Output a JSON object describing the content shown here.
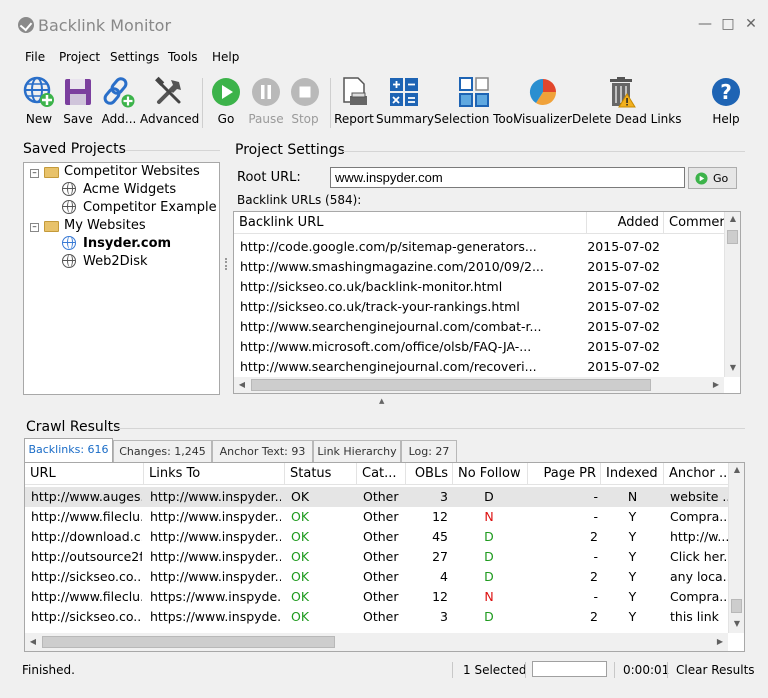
{
  "app": {
    "title": "Backlink Monitor"
  },
  "menu": [
    "File",
    "Project",
    "Settings",
    "Tools",
    "Help"
  ],
  "toolbar": {
    "new": "New",
    "save": "Save",
    "add": "Add...",
    "advanced": "Advanced",
    "go": "Go",
    "pause": "Pause",
    "stop": "Stop",
    "report": "Report",
    "summary": "Summary",
    "selection_tool": "Selection Tool",
    "visualizer": "Visualizer",
    "delete_dead_links": "Delete Dead Links",
    "help": "Help"
  },
  "saved_projects": {
    "title": "Saved Projects",
    "groups": [
      {
        "name": "Competitor Websites",
        "items": [
          "Acme Widgets",
          "Competitor Example"
        ]
      },
      {
        "name": "My Websites",
        "items": [
          "Insyder.com",
          "Web2Disk"
        ]
      }
    ]
  },
  "project_settings": {
    "title": "Project Settings",
    "root_url_label": "Root URL:",
    "root_url_value": "www.inspyder.com",
    "go_label": "Go",
    "backlink_urls_label": "Backlink URLs (584):",
    "columns": [
      "Backlink URL",
      "Added",
      "Commer"
    ],
    "rows": [
      {
        "url": "http://code.google.com/p/sitemap-generators...",
        "added": "2015-07-02"
      },
      {
        "url": "http://www.smashingmagazine.com/2010/09/2...",
        "added": "2015-07-02"
      },
      {
        "url": "http://sickseo.co.uk/backlink-monitor.html",
        "added": "2015-07-02"
      },
      {
        "url": "http://sickseo.co.uk/track-your-rankings.html",
        "added": "2015-07-02"
      },
      {
        "url": "http://www.searchenginejournal.com/combat-r...",
        "added": "2015-07-02"
      },
      {
        "url": "http://www.microsoft.com/office/olsb/FAQ-JA-...",
        "added": "2015-07-02"
      },
      {
        "url": "http://www.searchenginejournal.com/recoveri...",
        "added": "2015-07-02"
      }
    ]
  },
  "crawl_results": {
    "title": "Crawl Results",
    "tabs": [
      "Backlinks: 616",
      "Changes: 1,245",
      "Anchor Text: 93",
      "Link Hierarchy",
      "Log: 27"
    ],
    "columns": [
      "URL",
      "Links To",
      "Status",
      "Cat...",
      "OBLs",
      "No Follow",
      "Page PR",
      "Indexed",
      "Anchor ..."
    ],
    "rows": [
      {
        "url": "http://www.auges...",
        "links_to": "http://www.inspyder....",
        "status": "OK",
        "cat": "Other",
        "obls": "3",
        "nofollow": "D",
        "pr": "-",
        "indexed": "N",
        "anchor": "website ..."
      },
      {
        "url": "http://www.fileclu...",
        "links_to": "http://www.inspyder....",
        "status": "OK",
        "cat": "Other",
        "obls": "12",
        "nofollow": "N",
        "pr": "-",
        "indexed": "Y",
        "anchor": "Compra..."
      },
      {
        "url": "http://download.c...",
        "links_to": "http://www.inspyder....",
        "status": "OK",
        "cat": "Other",
        "obls": "45",
        "nofollow": "D",
        "pr": "2",
        "indexed": "Y",
        "anchor": "http://w..."
      },
      {
        "url": "http://outsource2f...",
        "links_to": "http://www.inspyder....",
        "status": "OK",
        "cat": "Other",
        "obls": "27",
        "nofollow": "D",
        "pr": "-",
        "indexed": "Y",
        "anchor": "Click her..."
      },
      {
        "url": "http://sickseo.co....",
        "links_to": "http://www.inspyder....",
        "status": "OK",
        "cat": "Other",
        "obls": "4",
        "nofollow": "D",
        "pr": "2",
        "indexed": "Y",
        "anchor": "any loca..."
      },
      {
        "url": "http://www.fileclu...",
        "links_to": "https://www.inspyde...",
        "status": "OK",
        "cat": "Other",
        "obls": "12",
        "nofollow": "N",
        "pr": "-",
        "indexed": "Y",
        "anchor": "Compra..."
      },
      {
        "url": "http://sickseo.co....",
        "links_to": "https://www.inspyde...",
        "status": "OK",
        "cat": "Other",
        "obls": "3",
        "nofollow": "D",
        "pr": "2",
        "indexed": "Y",
        "anchor": "this link"
      }
    ]
  },
  "statusbar": {
    "message": "Finished.",
    "selected": "1 Selected",
    "elapsed": "0:00:01",
    "clear": "Clear Results"
  },
  "colors": {
    "accent": "#1a6cc7",
    "ok_green": "#1e9a1e",
    "nofollow_red": "#dd1111",
    "go_green": "#3cb34a"
  }
}
